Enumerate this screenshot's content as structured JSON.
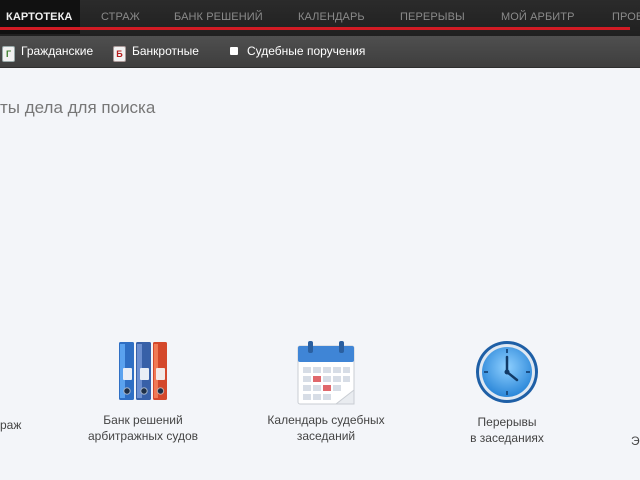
{
  "topnav": {
    "tabs": [
      {
        "label": "КАРТОТЕКА",
        "active": true
      },
      {
        "label": "СТРАЖ"
      },
      {
        "label": "БАНК РЕШЕНИЙ"
      },
      {
        "label": "КАЛЕНДАРЬ"
      },
      {
        "label": "ПЕРЕРЫВЫ"
      },
      {
        "label": "МОЙ АРБИТР"
      },
      {
        "label": "ПРОВ"
      }
    ],
    "accent_color": "#d21b24"
  },
  "subnav": {
    "items": [
      {
        "badge": "Г",
        "label": "Гражданские"
      },
      {
        "badge": "Б",
        "label": "Банкротные"
      },
      {
        "label": "Судебные поручения"
      }
    ]
  },
  "main": {
    "heading": "ты дела для поиска"
  },
  "tiles": {
    "left_edge": "раж",
    "items": [
      {
        "line1": "Банк решений",
        "line2": "арбитражных судов",
        "icon": "binders-icon"
      },
      {
        "line1": "Календарь судебных",
        "line2": "заседаний",
        "icon": "calendar-icon"
      },
      {
        "line1": "Перерывы",
        "line2": "в заседаниях",
        "icon": "clock-icon"
      }
    ],
    "right_edge": "Э"
  }
}
